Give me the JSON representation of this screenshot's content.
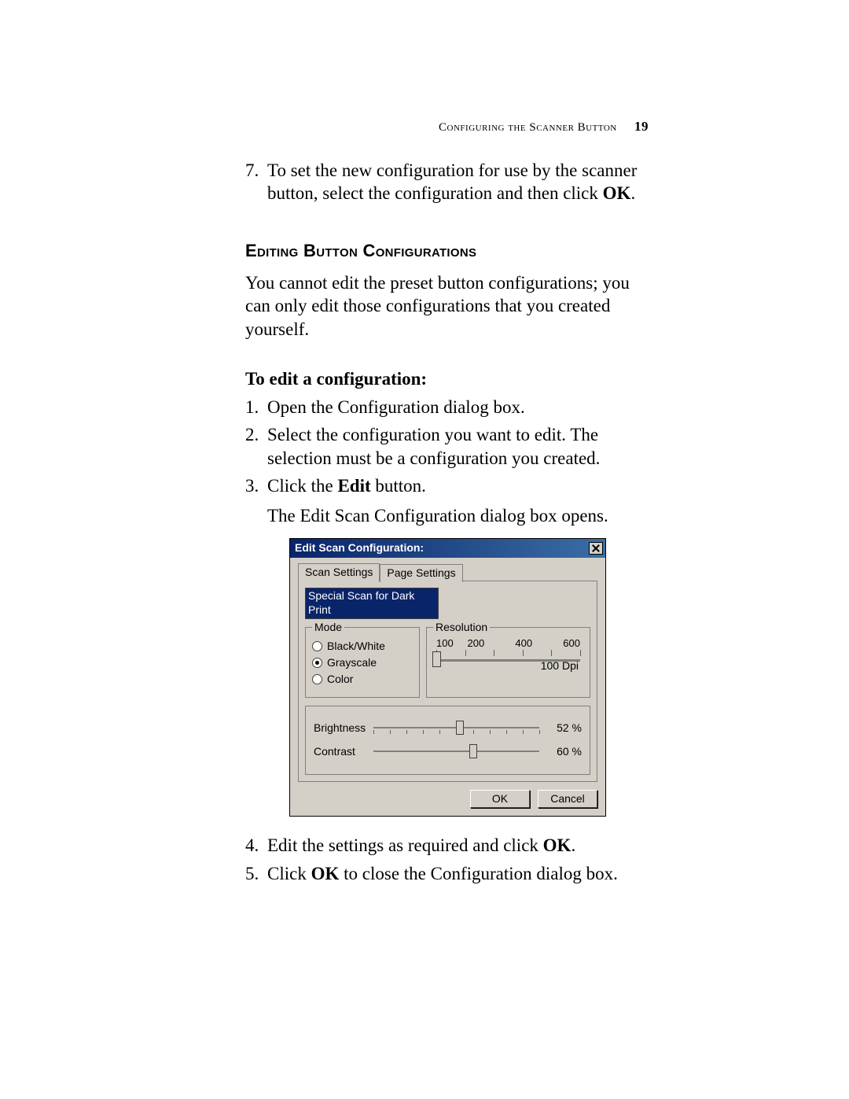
{
  "header": {
    "running": "Configuring the Scanner Button",
    "page_number": "19"
  },
  "intro_step": {
    "num": "7.",
    "text_before": "To set the new configuration for use by the scanner button, select the configuration and then click ",
    "bold": "OK",
    "text_after": "."
  },
  "section_title": "Editing Button Configurations",
  "section_intro": "You cannot edit the preset button configurations; you can only edit those configurations that you created yourself.",
  "subhead": "To edit a configuration:",
  "steps": [
    {
      "num": "1.",
      "parts": [
        {
          "t": "Open the Configuration dialog box."
        }
      ]
    },
    {
      "num": "2.",
      "parts": [
        {
          "t": "Select the configuration you want to edit. The selection must be a configuration you created."
        }
      ]
    },
    {
      "num": "3.",
      "parts": [
        {
          "t": "Click the "
        },
        {
          "b": "Edit"
        },
        {
          "t": " button."
        }
      ],
      "sub": "The Edit Scan Configuration dialog box opens."
    },
    {
      "num": "4.",
      "parts": [
        {
          "t": "Edit the settings as required and click "
        },
        {
          "b": "OK"
        },
        {
          "t": "."
        }
      ]
    },
    {
      "num": "5.",
      "parts": [
        {
          "t": "Click "
        },
        {
          "b": "OK"
        },
        {
          "t": " to close the Configuration dialog box."
        }
      ]
    }
  ],
  "dialog": {
    "title": "Edit Scan Configuration:",
    "tabs": {
      "active": "Scan Settings",
      "other": "Page Settings"
    },
    "name_value": "Special Scan for Dark Print",
    "mode": {
      "legend": "Mode",
      "options": [
        "Black/White",
        "Grayscale",
        "Color"
      ],
      "selected": "Grayscale"
    },
    "resolution": {
      "legend": "Resolution",
      "ticks": [
        "100",
        "200",
        "400",
        "600"
      ],
      "value": "100  Dpi"
    },
    "brightness": {
      "label": "Brightness",
      "value": "52 %",
      "pos": 0.52
    },
    "contrast": {
      "label": "Contrast",
      "value": "60 %",
      "pos": 0.6
    },
    "buttons": {
      "ok": "OK",
      "cancel": "Cancel"
    }
  }
}
